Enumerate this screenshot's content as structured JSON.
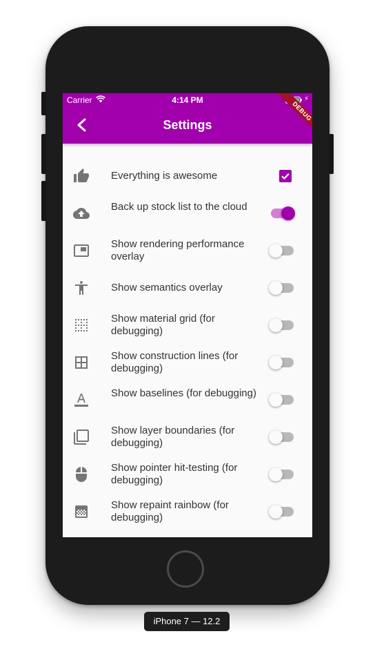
{
  "status_bar": {
    "carrier": "Carrier",
    "time": "4:14 PM"
  },
  "app_bar": {
    "title": "Settings",
    "debug_banner": "DEBUG",
    "color": "#a100ac"
  },
  "settings": [
    {
      "icon": "thumb-up-icon",
      "label": "Everything is awesome",
      "control": "checkbox",
      "checked": true
    },
    {
      "icon": "cloud-upload-icon",
      "label": "Back up stock list to the cloud",
      "control": "switch",
      "on": true
    },
    {
      "icon": "picture-in-picture-icon",
      "label": "Show rendering performance overlay",
      "control": "switch",
      "on": false
    },
    {
      "icon": "accessibility-icon",
      "label": "Show semantics overlay",
      "control": "switch",
      "on": false
    },
    {
      "icon": "dots-grid-icon",
      "label": "Show material grid (for debugging)",
      "control": "switch",
      "on": false
    },
    {
      "icon": "border-all-icon",
      "label": "Show construction lines (for debugging)",
      "control": "switch",
      "on": false
    },
    {
      "icon": "text-baseline-icon",
      "label": "Show baselines (for debugging)",
      "control": "switch",
      "on": false
    },
    {
      "icon": "filter-none-icon",
      "label": "Show layer boundaries (for debugging)",
      "control": "switch",
      "on": false
    },
    {
      "icon": "mouse-icon",
      "label": "Show pointer hit-testing (for debugging)",
      "control": "switch",
      "on": false
    },
    {
      "icon": "gradient-icon",
      "label": "Show repaint rainbow (for debugging)",
      "control": "switch",
      "on": false
    }
  ],
  "device_label": "iPhone 7 — 12.2"
}
